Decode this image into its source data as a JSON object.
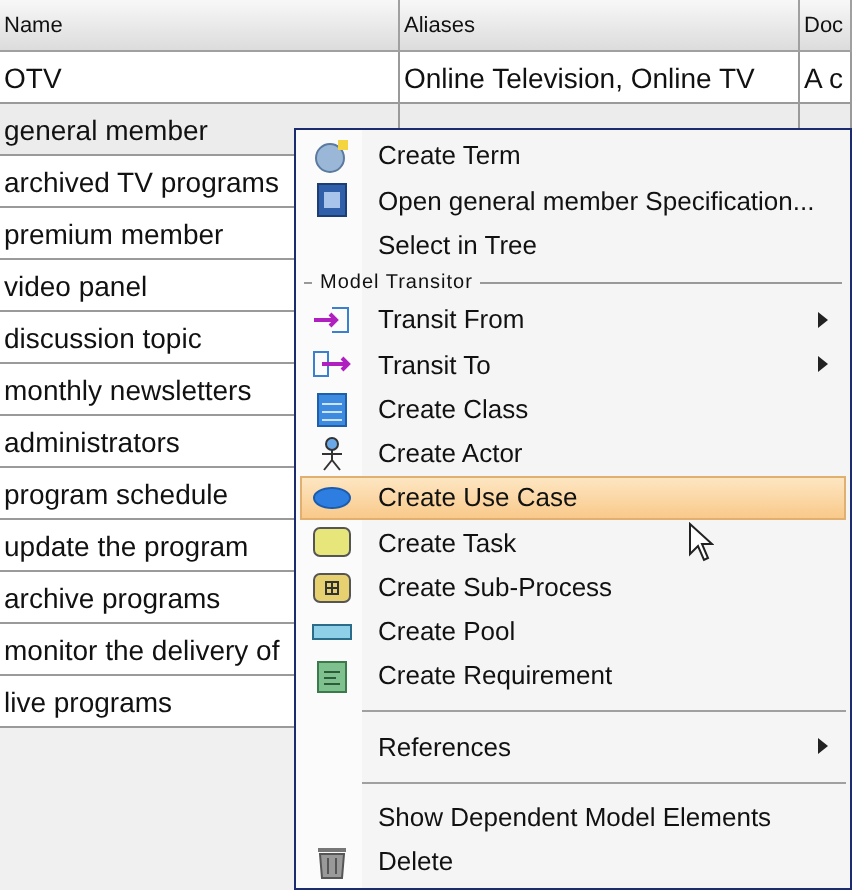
{
  "table": {
    "columns": [
      "Name",
      "Aliases",
      "Doc"
    ],
    "rows": [
      {
        "cells": [
          "OTV",
          "Online Television, Online TV",
          "A c"
        ],
        "selected": false
      },
      {
        "cells": [
          "general member"
        ],
        "selected": true
      },
      {
        "cells": [
          "archived TV programs"
        ],
        "selected": false
      },
      {
        "cells": [
          "premium member"
        ],
        "selected": false
      },
      {
        "cells": [
          "video panel"
        ],
        "selected": false
      },
      {
        "cells": [
          "discussion topic"
        ],
        "selected": false
      },
      {
        "cells": [
          "monthly newsletters"
        ],
        "selected": false
      },
      {
        "cells": [
          "administrators"
        ],
        "selected": false
      },
      {
        "cells": [
          "program schedule"
        ],
        "selected": false
      },
      {
        "cells": [
          "update the program"
        ],
        "selected": false
      },
      {
        "cells": [
          "archive programs"
        ],
        "selected": false
      },
      {
        "cells": [
          "monitor the delivery of"
        ],
        "selected": false
      },
      {
        "cells": [
          "live programs"
        ],
        "selected": false
      }
    ]
  },
  "context_menu": {
    "items": [
      {
        "kind": "item",
        "label": "Create Term",
        "submenu": false,
        "highlighted": false
      },
      {
        "kind": "item",
        "label": "Open general member Specification...",
        "submenu": false,
        "highlighted": false
      },
      {
        "kind": "item",
        "label": "Select in Tree",
        "submenu": false,
        "highlighted": false
      },
      {
        "kind": "group",
        "label": "Model Transitor"
      },
      {
        "kind": "item",
        "label": "Transit From",
        "submenu": true,
        "highlighted": false
      },
      {
        "kind": "item",
        "label": "Transit To",
        "submenu": true,
        "highlighted": false
      },
      {
        "kind": "item",
        "label": "Create Class",
        "submenu": false,
        "highlighted": false
      },
      {
        "kind": "item",
        "label": "Create Actor",
        "submenu": false,
        "highlighted": false
      },
      {
        "kind": "item",
        "label": "Create Use Case",
        "submenu": false,
        "highlighted": true
      },
      {
        "kind": "item",
        "label": "Create Task",
        "submenu": false,
        "highlighted": false
      },
      {
        "kind": "item",
        "label": "Create Sub-Process",
        "submenu": false,
        "highlighted": false
      },
      {
        "kind": "item",
        "label": "Create Pool",
        "submenu": false,
        "highlighted": false
      },
      {
        "kind": "item",
        "label": "Create Requirement",
        "submenu": false,
        "highlighted": false
      },
      {
        "kind": "separator"
      },
      {
        "kind": "item",
        "label": "References",
        "submenu": true,
        "highlighted": false
      },
      {
        "kind": "separator"
      },
      {
        "kind": "item",
        "label": "Show Dependent Model Elements",
        "submenu": false,
        "highlighted": false
      },
      {
        "kind": "item",
        "label": "Delete",
        "submenu": false,
        "highlighted": false
      }
    ]
  }
}
